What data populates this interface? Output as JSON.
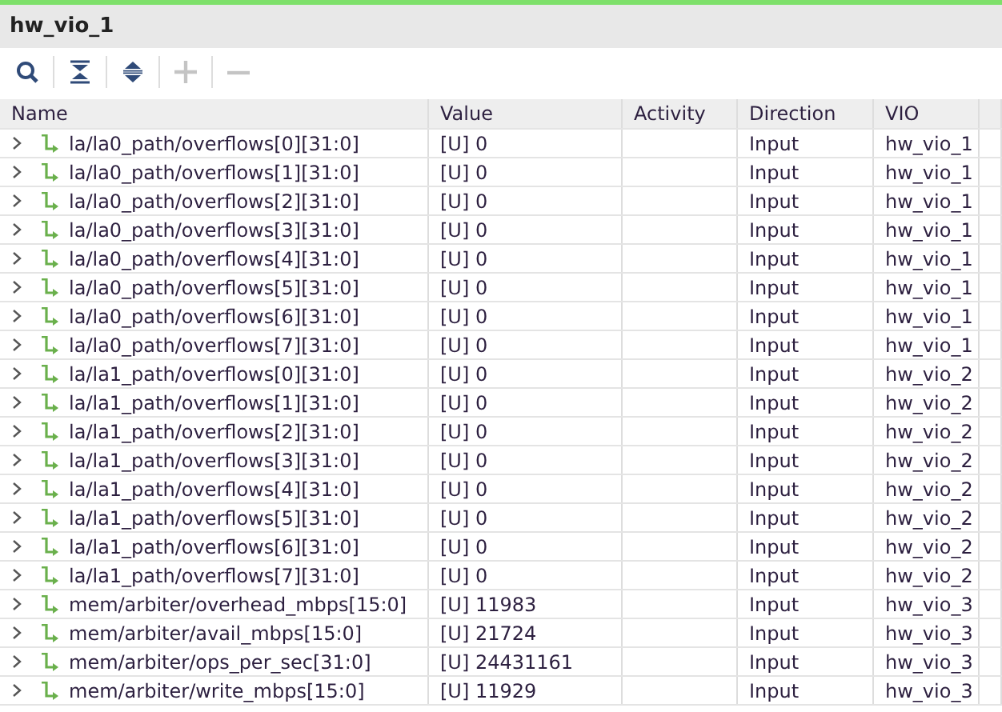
{
  "panel": {
    "title": "hw_vio_1"
  },
  "toolbar": [
    {
      "kind": "search",
      "disabled": false
    },
    {
      "kind": "collapse",
      "disabled": false
    },
    {
      "kind": "expand",
      "disabled": false
    },
    {
      "kind": "plus",
      "disabled": true
    },
    {
      "kind": "minus",
      "disabled": true
    }
  ],
  "table": {
    "columns": [
      "Name",
      "Value",
      "Activity",
      "Direction",
      "VIO"
    ],
    "rows": [
      {
        "name": "la/la0_path/overflows[0][31:0]",
        "value": "[U] 0",
        "direction": "Input",
        "vio": "hw_vio_1",
        "expanded": false
      },
      {
        "name": "la/la0_path/overflows[1][31:0]",
        "value": "[U] 0",
        "direction": "Input",
        "vio": "hw_vio_1",
        "expanded": false
      },
      {
        "name": "la/la0_path/overflows[2][31:0]",
        "value": "[U] 0",
        "direction": "Input",
        "vio": "hw_vio_1",
        "expanded": false
      },
      {
        "name": "la/la0_path/overflows[3][31:0]",
        "value": "[U] 0",
        "direction": "Input",
        "vio": "hw_vio_1",
        "expanded": false
      },
      {
        "name": "la/la0_path/overflows[4][31:0]",
        "value": "[U] 0",
        "direction": "Input",
        "vio": "hw_vio_1",
        "expanded": false
      },
      {
        "name": "la/la0_path/overflows[5][31:0]",
        "value": "[U] 0",
        "direction": "Input",
        "vio": "hw_vio_1",
        "expanded": false
      },
      {
        "name": "la/la0_path/overflows[6][31:0]",
        "value": "[U] 0",
        "direction": "Input",
        "vio": "hw_vio_1",
        "expanded": false
      },
      {
        "name": "la/la0_path/overflows[7][31:0]",
        "value": "[U] 0",
        "direction": "Input",
        "vio": "hw_vio_1",
        "expanded": false
      },
      {
        "name": "la/la1_path/overflows[0][31:0]",
        "value": "[U] 0",
        "direction": "Input",
        "vio": "hw_vio_2",
        "expanded": false
      },
      {
        "name": "la/la1_path/overflows[1][31:0]",
        "value": "[U] 0",
        "direction": "Input",
        "vio": "hw_vio_2",
        "expanded": false
      },
      {
        "name": "la/la1_path/overflows[2][31:0]",
        "value": "[U] 0",
        "direction": "Input",
        "vio": "hw_vio_2",
        "expanded": false
      },
      {
        "name": "la/la1_path/overflows[3][31:0]",
        "value": "[U] 0",
        "direction": "Input",
        "vio": "hw_vio_2",
        "expanded": false
      },
      {
        "name": "la/la1_path/overflows[4][31:0]",
        "value": "[U] 0",
        "direction": "Input",
        "vio": "hw_vio_2",
        "expanded": false
      },
      {
        "name": "la/la1_path/overflows[5][31:0]",
        "value": "[U] 0",
        "direction": "Input",
        "vio": "hw_vio_2",
        "expanded": false
      },
      {
        "name": "la/la1_path/overflows[6][31:0]",
        "value": "[U] 0",
        "direction": "Input",
        "vio": "hw_vio_2",
        "expanded": false
      },
      {
        "name": "la/la1_path/overflows[7][31:0]",
        "value": "[U] 0",
        "direction": "Input",
        "vio": "hw_vio_2",
        "expanded": false
      },
      {
        "name": "mem/arbiter/overhead_mbps[15:0]",
        "value": "[U] 11983",
        "direction": "Input",
        "vio": "hw_vio_3",
        "expanded": false
      },
      {
        "name": "mem/arbiter/avail_mbps[15:0]",
        "value": "[U] 21724",
        "direction": "Input",
        "vio": "hw_vio_3",
        "expanded": false
      },
      {
        "name": "mem/arbiter/ops_per_sec[31:0]",
        "value": "[U] 24431161",
        "direction": "Input",
        "vio": "hw_vio_3",
        "expanded": false
      },
      {
        "name": "mem/arbiter/write_mbps[15:0]",
        "value": "[U] 11929",
        "direction": "Input",
        "vio": "hw_vio_3",
        "expanded": false
      }
    ]
  }
}
